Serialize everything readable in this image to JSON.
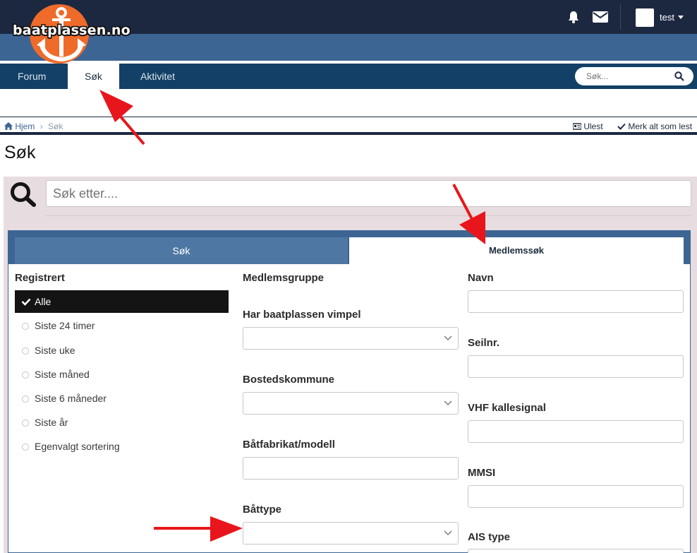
{
  "header": {
    "logo_text": "baatplassen.no",
    "username": "test"
  },
  "nav": {
    "tabs": [
      "Forum",
      "Søk",
      "Aktivitet"
    ],
    "search_placeholder": "Søk..."
  },
  "breadcrumb": {
    "home": "Hjem",
    "current": "Søk",
    "unread_label": "Ulest",
    "mark_read_label": "Merk alt som lest"
  },
  "page": {
    "title": "Søk",
    "search_placeholder": "Søk etter...."
  },
  "form_tabs": {
    "search_label": "Søk",
    "member_search_label": "Medlemssøk"
  },
  "registered": {
    "label": "Registrert",
    "active_option": "Alle",
    "options": [
      "Siste 24 timer",
      "Siste uke",
      "Siste måned",
      "Siste 6 måneder",
      "Siste år",
      "Egenvalgt sortering"
    ]
  },
  "middle": {
    "member_group_label": "Medlemsgruppe",
    "pennant_label": "Har baatplassen vimpel",
    "municipality_label": "Bostedskommune",
    "boat_make_label": "Båtfabrikat/modell",
    "boat_type_label": "Båttype"
  },
  "right": {
    "name_label": "Navn",
    "sail_label": "Seilnr.",
    "vhf_label": "VHF kallesignal",
    "mmsi_label": "MMSI",
    "ais_label": "AIS type"
  },
  "colors": {
    "header_dark": "#1b2840",
    "header_blue": "#3d6593",
    "nav_blue": "#134066",
    "logo_orange": "#ef6b2a",
    "panel_bg": "#e7dde0",
    "annotation_red": "#e8161c"
  }
}
